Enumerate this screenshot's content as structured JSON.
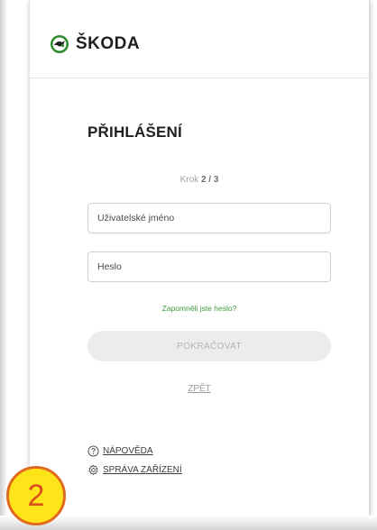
{
  "brand": {
    "name": "ŠKODA",
    "logo_icon": "skoda-arrow-icon"
  },
  "login": {
    "title": "PŘIHLÁŠENÍ",
    "step_prefix": "Krok",
    "step_current": "2 / 3",
    "username_placeholder": "Uživatelské jméno",
    "password_placeholder": "Heslo",
    "forgot_link": "Zapomněli jste heslo?",
    "continue_label": "POKRAČOVAT",
    "back_label": "ZPĚT"
  },
  "footer": {
    "help_label": "NÁPOVĚDA",
    "help_icon": "question-circle-icon",
    "devices_label": "SPRÁVA ZAŘÍZENÍ",
    "devices_icon": "gear-icon"
  },
  "annotation": {
    "badge_number": "2"
  },
  "colors": {
    "link_green": "#3d9b3f",
    "badge_fill": "#ffe41a",
    "badge_border": "#e06b1f",
    "button_disabled_bg": "#ececec"
  }
}
